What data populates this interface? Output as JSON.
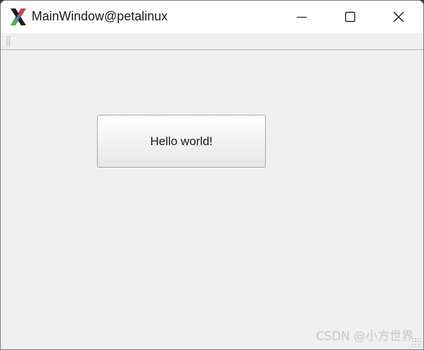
{
  "window": {
    "title": "MainWindow@petalinux",
    "icon": "x-logo-icon",
    "controls": [
      "minimize-icon",
      "maximize-icon",
      "close-icon"
    ]
  },
  "main": {
    "button_label": "Hello world!"
  },
  "watermark": "CSDN @小方世界",
  "colors": {
    "titlebar_bg": "#ffffff",
    "window_bg": "#efefef"
  }
}
